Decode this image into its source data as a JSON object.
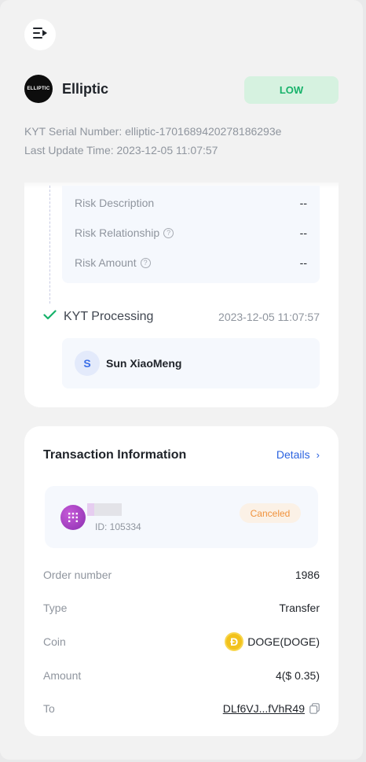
{
  "header": {
    "brand_logo_text": "ELLIPTIC",
    "brand_name": "Elliptic",
    "risk_level": "LOW",
    "serial_number": "KYT Serial Number: elliptic-1701689420278186293e",
    "last_update": "Last Update Time: 2023-12-05 11:07:57"
  },
  "risk": {
    "rows": [
      {
        "label": "Risk Description",
        "value": "--",
        "help": false
      },
      {
        "label": "Risk Relationship",
        "value": "--",
        "help": true
      },
      {
        "label": "Risk Amount",
        "value": "--",
        "help": true
      }
    ],
    "help_glyph": "?"
  },
  "step": {
    "title": "KYT Processing",
    "time": "2023-12-05 11:07:57",
    "user_initial": "S",
    "user_name": "Sun XiaoMeng"
  },
  "transaction": {
    "title": "Transaction Information",
    "details_label": "Details",
    "chevron": "›",
    "id_text": "ID: 105334",
    "status": "Canceled",
    "fields": [
      {
        "label": "Order number",
        "value": "1986"
      },
      {
        "label": "Type",
        "value": "Transfer"
      },
      {
        "label": "Coin",
        "value": "DOGE(DOGE)",
        "coin_glyph": "Ð"
      },
      {
        "label": "Amount",
        "value": "4($ 0.35)"
      },
      {
        "label": "To",
        "value": "DLf6VJ...fVhR49"
      }
    ]
  },
  "colors": {
    "risk_low": "#17b26a",
    "link": "#2b63e0",
    "status_canceled": "#f0923c",
    "check": "#17b26a"
  },
  "icons": {
    "menu": "menu-collapse-icon",
    "check": "check-icon",
    "copy": "copy-icon",
    "token": "token-icon",
    "coin": "doge-coin-icon"
  }
}
